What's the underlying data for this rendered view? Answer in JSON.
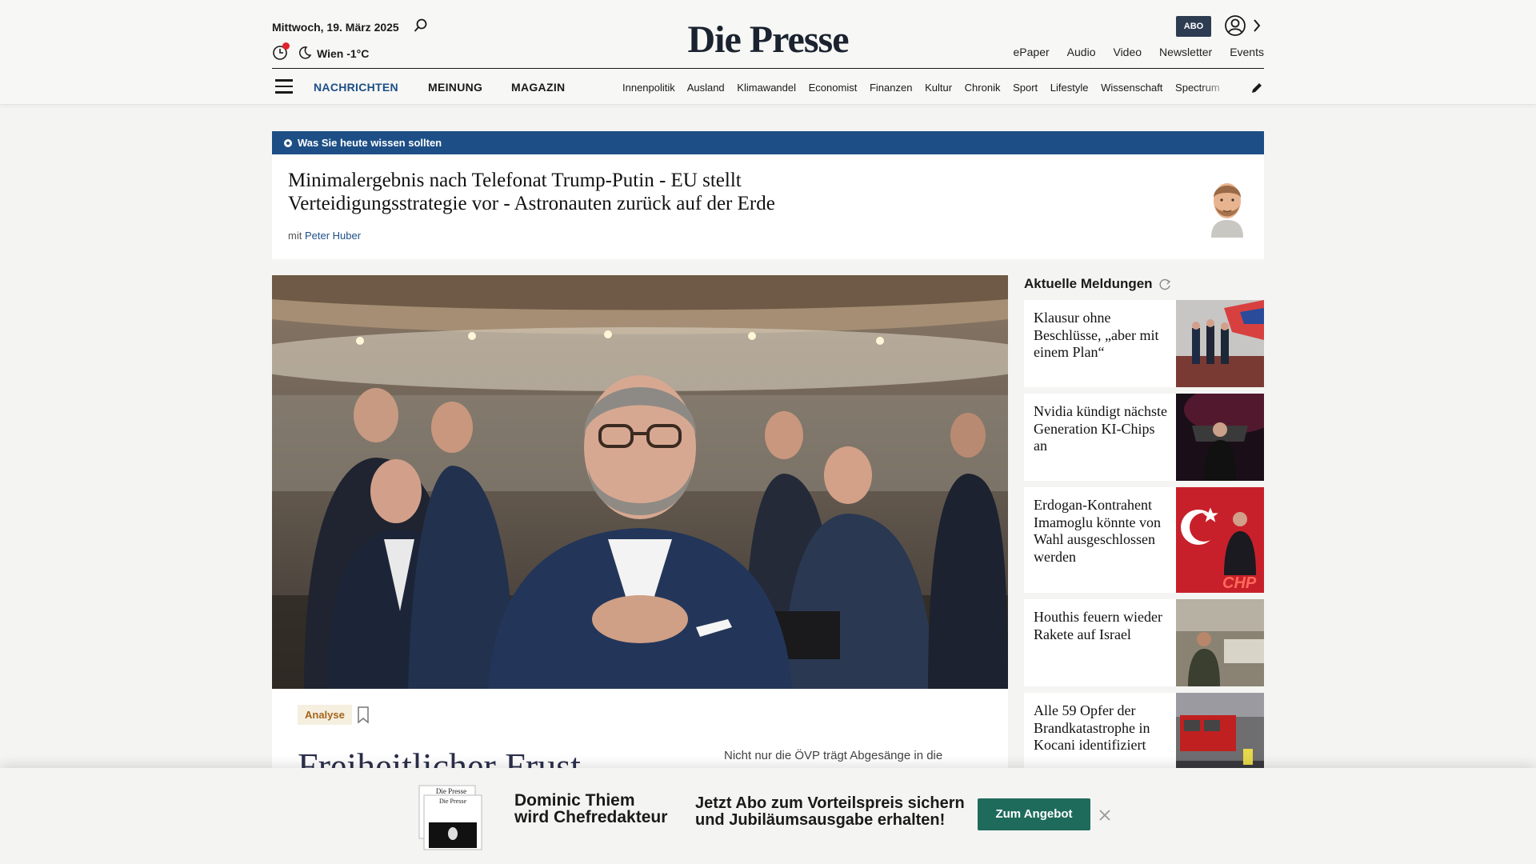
{
  "header": {
    "date": "Mittwoch, 19. März 2025",
    "weather": "Wien -1°C",
    "logo": "Die Presse",
    "abo_label": "ABO",
    "top_links": [
      "ePaper",
      "Audio",
      "Video",
      "Newsletter",
      "Events"
    ],
    "main_nav": [
      "NACHRICHTEN",
      "MEINUNG",
      "MAGAZIN"
    ],
    "sub_nav": [
      "Innenpolitik",
      "Ausland",
      "Klimawandel",
      "Economist",
      "Finanzen",
      "Kultur",
      "Chronik",
      "Sport",
      "Lifestyle",
      "Wissenschaft",
      "Spectrum"
    ],
    "icons": [
      "search-icon",
      "clock-icon",
      "moon-icon",
      "user-icon",
      "chevron-right-icon",
      "menu-icon",
      "pencil-icon"
    ],
    "accent_color": "#1d4f86",
    "notification_color": "#e0242a"
  },
  "briefing": {
    "label": "Was Sie heute wissen sollten",
    "title": "Minimalergebnis nach Telefonat Trump-Putin - EU stellt Verteidigungsstrategie vor - Astronauten zurück auf der Erde",
    "author_prefix": "mit",
    "author": "Peter Huber"
  },
  "hero": {
    "tag": "Analyse",
    "title": "Freiheitlicher Frust",
    "teaser": "Nicht nur die ÖVP trägt Abgesänge in die"
  },
  "sidebar": {
    "heading": "Aktuelle Meldungen",
    "items": [
      {
        "title": "Klausur ohne Beschlüsse, „aber mit einem Plan“"
      },
      {
        "title": "Nvidia kündigt nächste Generation KI-Chips an"
      },
      {
        "title": "Erdogan-Kontrahent Imamoglu könnte von Wahl ausgeschlossen werden"
      },
      {
        "title": "Houthis feuern wieder Rakete auf Israel"
      },
      {
        "title": "Alle 59 Opfer der Brandkatastrophe in Kocani identifiziert"
      }
    ]
  },
  "promo": {
    "paper_mast": "Die Presse",
    "name_line1": "Dominic Thiem",
    "name_line2": "wird Chefredakteur",
    "offer_line1": "Jetzt Abo zum Vorteilspreis sichern",
    "offer_line2": "und Jubiläumsausgabe erhalten!",
    "button": "Zum Angebot",
    "button_color": "#1e6b5c"
  }
}
